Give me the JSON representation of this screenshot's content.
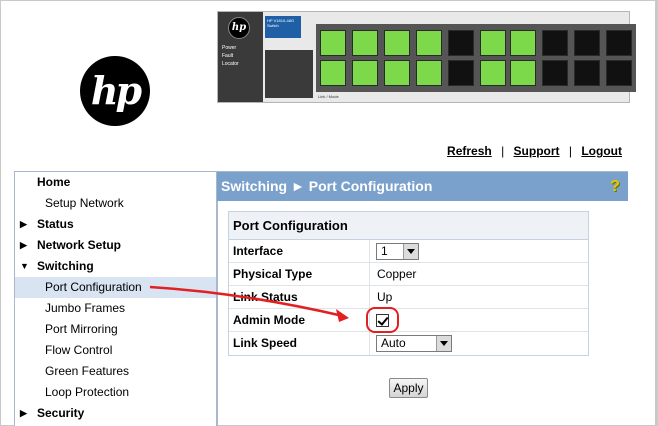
{
  "logo": {
    "text": "hp"
  },
  "switch_image": {
    "mini_logo": "hp",
    "model_label": "HP V1810-48G Switch",
    "led_labels": [
      "Power",
      "Fault",
      "Locator"
    ],
    "legend": "Link / Mode"
  },
  "top_links": {
    "refresh": "Refresh",
    "support": "Support",
    "logout": "Logout",
    "separator": "|"
  },
  "sidebar": {
    "items": [
      {
        "label": "Home",
        "level": "top",
        "arrow": ""
      },
      {
        "label": "Setup Network",
        "level": "sub"
      },
      {
        "label": "Status",
        "level": "top",
        "arrow": "▶"
      },
      {
        "label": "Network Setup",
        "level": "top",
        "arrow": "▶"
      },
      {
        "label": "Switching",
        "level": "top",
        "arrow": "▼"
      },
      {
        "label": "Port Configuration",
        "level": "sub",
        "active": true
      },
      {
        "label": "Jumbo Frames",
        "level": "sub"
      },
      {
        "label": "Port Mirroring",
        "level": "sub"
      },
      {
        "label": "Flow Control",
        "level": "sub"
      },
      {
        "label": "Green Features",
        "level": "sub"
      },
      {
        "label": "Loop Protection",
        "level": "sub"
      },
      {
        "label": "Security",
        "level": "top",
        "arrow": "▶"
      }
    ]
  },
  "header": {
    "title": "Switching ► Port Configuration",
    "help_icon": "question-mark-icon"
  },
  "config": {
    "title": "Port Configuration",
    "interface_label": "Interface",
    "interface_value": "1",
    "physical_type_label": "Physical Type",
    "physical_type_value": "Copper",
    "link_status_label": "Link Status",
    "link_status_value": "Up",
    "admin_mode_label": "Admin Mode",
    "admin_mode_checked": true,
    "link_speed_label": "Link Speed",
    "link_speed_value": "Auto"
  },
  "apply_label": "Apply",
  "colors": {
    "header_bg": "#7aa0cc",
    "annotation": "#e32020",
    "port_active": "#7cd94a"
  }
}
